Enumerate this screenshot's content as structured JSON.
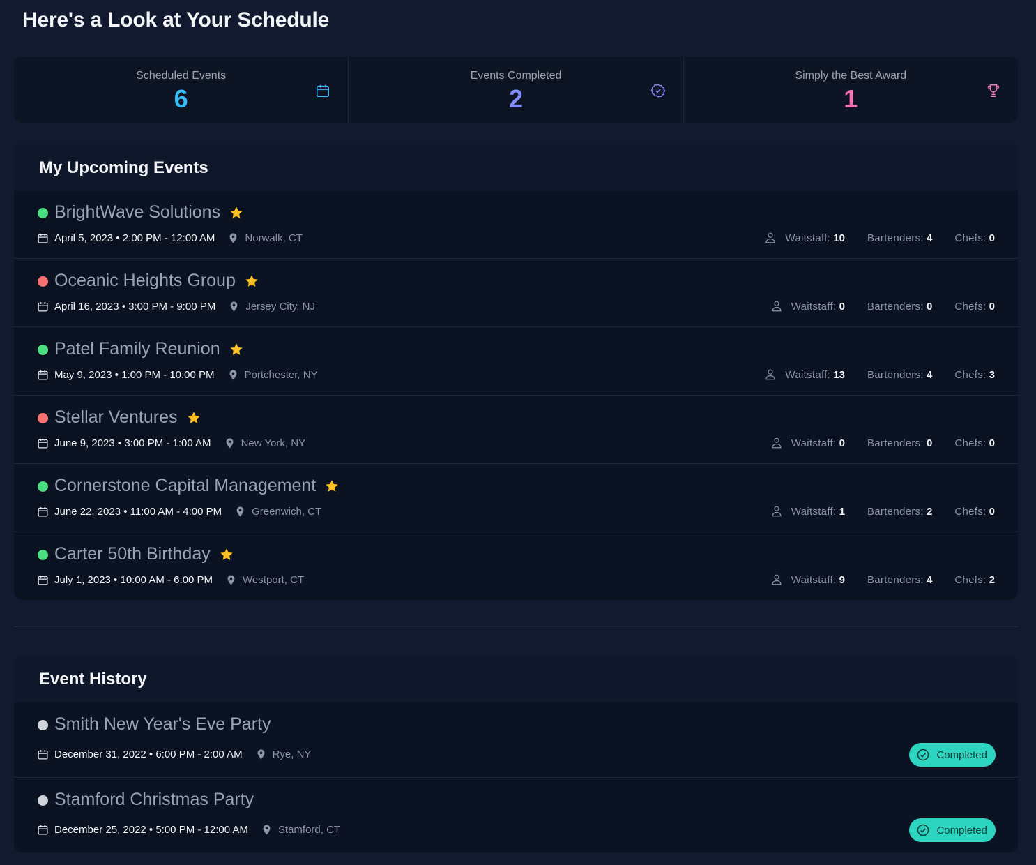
{
  "page_title": "Here's a Look at Your Schedule",
  "colors": {
    "background": "#111a2e",
    "scheduled": "#38bdf8",
    "completed_stat": "#818cf8",
    "award": "#f472b6",
    "status_green": "#4ade80",
    "status_red": "#f87171",
    "status_gray": "#d1d5db",
    "star": "#fbbf24",
    "badge": "#2dd4bf"
  },
  "stats": [
    {
      "label": "Scheduled Events",
      "value": "6",
      "icon": "calendar-icon"
    },
    {
      "label": "Events Completed",
      "value": "2",
      "icon": "badge-check-icon"
    },
    {
      "label": "Simply the Best Award",
      "value": "1",
      "icon": "trophy-icon"
    }
  ],
  "upcoming": {
    "title": "My Upcoming Events",
    "staff_labels": {
      "waitstaff": "Waitstaff:",
      "bartenders": "Bartenders:",
      "chefs": "Chefs:"
    },
    "events": [
      {
        "name": "BrightWave Solutions",
        "status": "green",
        "datetime": "April 5, 2023 • 2:00 PM - 12:00 AM",
        "location": "Norwalk, CT",
        "waitstaff": "10",
        "bartenders": "4",
        "chefs": "0"
      },
      {
        "name": "Oceanic Heights Group",
        "status": "red",
        "datetime": "April 16, 2023 • 3:00 PM - 9:00 PM",
        "location": "Jersey City, NJ",
        "waitstaff": "0",
        "bartenders": "0",
        "chefs": "0"
      },
      {
        "name": "Patel Family Reunion",
        "status": "green",
        "datetime": "May 9, 2023 • 1:00 PM - 10:00 PM",
        "location": "Portchester, NY",
        "waitstaff": "13",
        "bartenders": "4",
        "chefs": "3"
      },
      {
        "name": "Stellar Ventures",
        "status": "red",
        "datetime": "June 9, 2023 • 3:00 PM - 1:00 AM",
        "location": "New York, NY",
        "waitstaff": "0",
        "bartenders": "0",
        "chefs": "0"
      },
      {
        "name": "Cornerstone Capital Management",
        "status": "green",
        "datetime": "June 22, 2023 • 11:00 AM - 4:00 PM",
        "location": "Greenwich, CT",
        "waitstaff": "1",
        "bartenders": "2",
        "chefs": "0"
      },
      {
        "name": "Carter 50th Birthday",
        "status": "green",
        "datetime": "July 1, 2023 • 10:00 AM - 6:00 PM",
        "location": "Westport, CT",
        "waitstaff": "9",
        "bartenders": "4",
        "chefs": "2"
      }
    ]
  },
  "history": {
    "title": "Event History",
    "events": [
      {
        "name": "Smith New Year's Eve Party",
        "status": "gray",
        "datetime": "December 31, 2022 • 6:00 PM - 2:00 AM",
        "location": "Rye, NY",
        "badge": "Completed"
      },
      {
        "name": "Stamford Christmas Party",
        "status": "gray",
        "datetime": "December 25, 2022 • 5:00 PM - 12:00 AM",
        "location": "Stamford, CT",
        "badge": "Completed"
      }
    ]
  }
}
